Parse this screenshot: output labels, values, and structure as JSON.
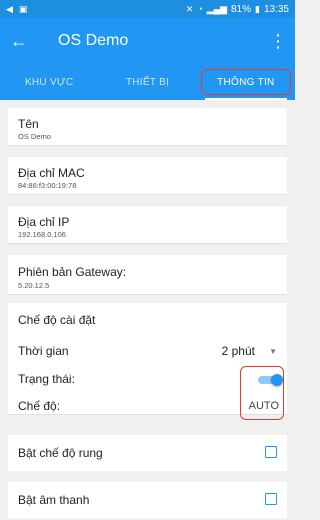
{
  "status_bar": {
    "battery": "81%",
    "time": "13:35"
  },
  "app_bar": {
    "title": "OS Demo"
  },
  "tabs": [
    {
      "label": "KHU VỰC"
    },
    {
      "label": "THIẾT BỊ"
    },
    {
      "label": "THÔNG TIN",
      "active": true
    }
  ],
  "info": [
    {
      "title": "Tên",
      "value": "OS Demo"
    },
    {
      "title": "Địa chỉ MAC",
      "value": "84:86:f3:00:19:78"
    },
    {
      "title": "Địa chỉ IP",
      "value": "192.168.0.106"
    },
    {
      "title": "Phiên bản Gateway:",
      "value": "5.20.12.5"
    }
  ],
  "settings": {
    "section_title": "Chế độ cài đặt",
    "time_label": "Thời gian",
    "time_value": "2 phút",
    "status_label": "Trạng thái:",
    "status_on": true,
    "mode_label": "Chế độ:",
    "mode_value": "AUTO"
  },
  "options": [
    {
      "label": "Bật chế độ rung",
      "checked": false
    },
    {
      "label": "Bật âm thanh",
      "checked": false
    }
  ],
  "colors": {
    "primary": "#2196f3",
    "highlight": "#e53935"
  }
}
